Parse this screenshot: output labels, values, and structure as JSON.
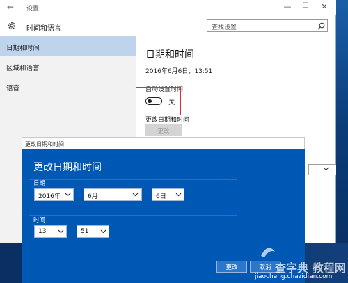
{
  "window": {
    "back_glyph": "←",
    "title": "设置",
    "minimize_glyph": "—",
    "maximize_glyph": "☐",
    "close_glyph": "✕"
  },
  "header": {
    "icon": "gear-icon",
    "title": "时间和语言",
    "search_placeholder": "查找设置",
    "search_icon": "search-icon"
  },
  "sidebar": {
    "items": [
      {
        "label": "日期和时间",
        "active": true
      },
      {
        "label": "区域和语言",
        "active": false
      },
      {
        "label": "语音",
        "active": false
      }
    ]
  },
  "content": {
    "title": "日期和时间",
    "current_datetime": "2016年6月6日，13:51",
    "auto_time_label": "自动设置时间",
    "auto_time_state": "关",
    "auto_time_on": false,
    "change_label": "更改日期和时间",
    "change_button": "更改"
  },
  "dialog": {
    "titlebar": "更改日期和时间",
    "heading": "更改日期和时间",
    "date_label": "日期",
    "year_value": "2016年",
    "month_value": "6月",
    "day_value": "6日",
    "time_label": "时间",
    "hour_value": "13",
    "minute_value": "51",
    "change_button": "更改",
    "cancel_button": "取消"
  },
  "watermark": {
    "text": "查字典 教程网",
    "url": "jiaocheng.chazidian.com"
  },
  "colors": {
    "accent": "#0058b5",
    "sidebar_active": "#bed3ec",
    "annotation": "#d9303a"
  }
}
